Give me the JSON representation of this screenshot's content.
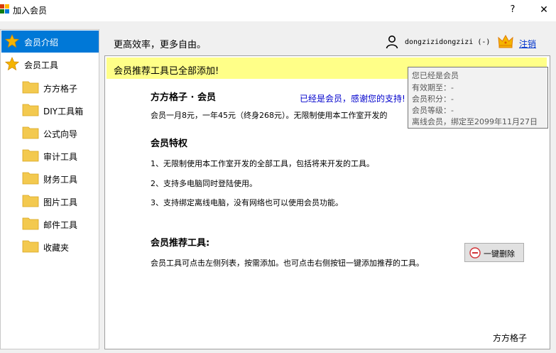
{
  "window": {
    "title": "加入会员",
    "help_label": "?",
    "close_label": "✕"
  },
  "sidebar": {
    "items": [
      {
        "label": "会员介绍",
        "icon": "star-icon",
        "selected": true
      },
      {
        "label": "会员工具",
        "icon": "star-icon",
        "selected": false
      }
    ],
    "tools": [
      {
        "label": "方方格子",
        "icon": "folder-icon"
      },
      {
        "label": "DIY工具箱",
        "icon": "folder-icon"
      },
      {
        "label": "公式向导",
        "icon": "folder-icon"
      },
      {
        "label": "审计工具",
        "icon": "folder-icon"
      },
      {
        "label": "财务工具",
        "icon": "folder-icon"
      },
      {
        "label": "图片工具",
        "icon": "folder-icon"
      },
      {
        "label": "邮件工具",
        "icon": "folder-icon"
      },
      {
        "label": "收藏夹",
        "icon": "folder-icon"
      }
    ]
  },
  "header": {
    "slogan": "更高效率，更多自由。",
    "username": "dongzizidongzizi (-)",
    "logout_label": "注销"
  },
  "banner": {
    "text": "会员推荐工具已全部添加!"
  },
  "content": {
    "product_title": "方方格子 · 会员",
    "thanks": "已经是会员，感谢您的支持!",
    "price_text": "会员一月8元，一年45元（终身268元）。无限制使用本工作室开发的",
    "privileges_title": "会员特权",
    "privileges": [
      "1、无限制使用本工作室开发的全部工具，包括将来开发的工具。",
      "2、支持多电脑同时登陆使用。",
      "3、支持绑定离线电脑，没有网络也可以使用会员功能。"
    ],
    "recommended_title": "会员推荐工具:",
    "recommended_desc": "会员工具可点击左侧列表，按需添加。也可点击右侧按钮一键添加推荐的工具。",
    "delete_button_label": "一键删除",
    "footer_brand": "方方格子"
  },
  "tooltip": {
    "lines": [
      "您已经是会员",
      "有效期至：-",
      "会员积分：-",
      "会员等级：-",
      "离线会员，绑定至2099年11月27日"
    ]
  },
  "colors": {
    "selected_bg": "#0078d7",
    "banner_bg": "#ffff88",
    "thanks_text": "#0000cc",
    "link": "#0033cc",
    "star": "#f5b400",
    "folder": "#f3c94f"
  }
}
